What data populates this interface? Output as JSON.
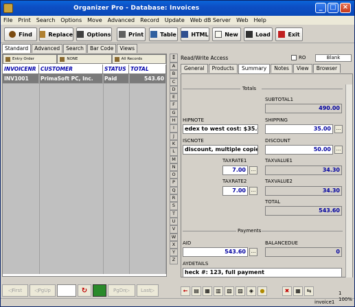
{
  "window": {
    "title": "Organizer Pro - Database: Invoices"
  },
  "menu": [
    "File",
    "Print",
    "Search",
    "Options",
    "Move",
    "Advanced",
    "Record",
    "Update",
    "Web dB Server",
    "Web",
    "Help"
  ],
  "toolbar": {
    "find": "Find",
    "replace": "Replace",
    "options": "Options",
    "print": "Print",
    "table": "Table",
    "html": "HTML",
    "new": "New",
    "load": "Load",
    "exit": "Exit"
  },
  "viewtabs": [
    "Standard",
    "Advanced",
    "Search",
    "Bar Code",
    "Views"
  ],
  "sort": {
    "entry": "Entry Order",
    "none": "NONE",
    "all": "All Records"
  },
  "table": {
    "headers": [
      "INVOICENR",
      "CUSTOMER",
      "STATUS",
      "TOTAL"
    ],
    "rows": [
      {
        "invoicenr": "INV1001",
        "customer": "PrimaSoft PC, Inc.",
        "status": "Paid",
        "total": "543.60"
      }
    ]
  },
  "nav": {
    "first": "First",
    "pgup": "PgUp",
    "pgdn": "PgDn",
    "last": "Last"
  },
  "alpha": [
    "A",
    "B",
    "C",
    "D",
    "E",
    "F",
    "G",
    "H",
    "I",
    "J",
    "K",
    "L",
    "M",
    "N",
    "O",
    "P",
    "Q",
    "R",
    "S",
    "T",
    "U",
    "V",
    "W",
    "X",
    "Y",
    "Z"
  ],
  "form": {
    "access": "Read/Write Access",
    "ro": "RO",
    "blank": "Blank",
    "tabs": [
      "General",
      "Products",
      "Summary",
      "Notes",
      "View",
      "Browser"
    ],
    "totals": "Totals",
    "subtotal_label": "SUBTOTAL1",
    "subtotal": "490.00",
    "shipnote_label": "HIPNOTE",
    "shipnote": "edex to west cost: $35.00",
    "shipping_label": "SHIPPING",
    "shipping": "35.00",
    "discnote_label": "ISCNOTE",
    "discnote": "discount, multiple copies",
    "discount_label": "DISCOUNT",
    "discount": "50.00",
    "taxrate1_label": "TAXRATE1",
    "taxrate1": "7.00",
    "taxvalue1_label": "TAXVALUE1",
    "taxvalue1": "34.30",
    "taxrate2_label": "TAXRATE2",
    "taxrate2": "7.00",
    "taxvalue2_label": "TAXVALUE2",
    "taxvalue2": "34.30",
    "total_label": "TOTAL",
    "total": "543.60",
    "payments": "Payments",
    "paid_label": "AID",
    "paid": "543.60",
    "balance_label": "BALANCEDUE",
    "balance": "0",
    "paydetails_label": "AYDETAILS",
    "paydetails": "heck #: 123, full payment",
    "ell": "..."
  },
  "status": {
    "record": "invoice1",
    "zoom": "100%",
    "count": "1"
  }
}
